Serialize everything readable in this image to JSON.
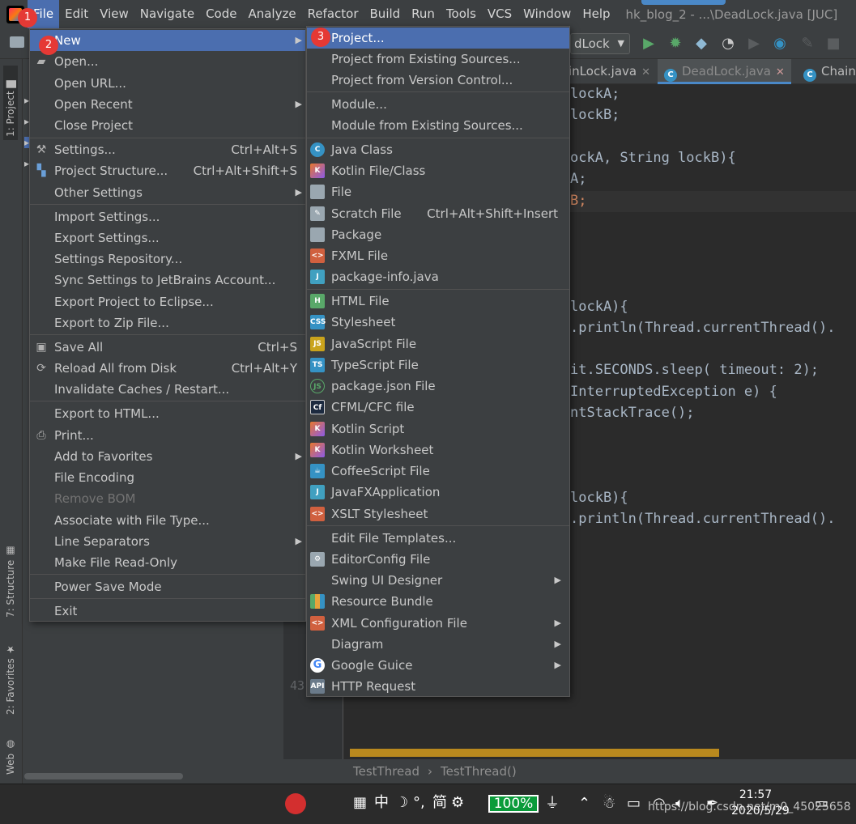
{
  "menubar": {
    "items": [
      "File",
      "Edit",
      "View",
      "Navigate",
      "Code",
      "Analyze",
      "Refactor",
      "Build",
      "Run",
      "Tools",
      "VCS",
      "Window",
      "Help"
    ],
    "window_title": "hk_blog_2 - ...\\DeadLock.java [JUC]"
  },
  "badges": [
    "1",
    "2",
    "3"
  ],
  "toolbar": {
    "run_config": "dLock",
    "icons": [
      "folder-icon",
      "run-icon",
      "debug-icon",
      "coverage-icon",
      "profile-icon",
      "build-icon",
      "help-icon",
      "wrench-icon",
      "stop-icon"
    ]
  },
  "left_strip": {
    "tabs": [
      "1: Project",
      "7: Structure",
      "2: Favorites",
      "Web"
    ]
  },
  "editor": {
    "tabs": [
      {
        "label": "inLock.java",
        "active": false
      },
      {
        "label": "DeadLock.java",
        "active": true
      },
      {
        "label": "ChainR",
        "active": false
      }
    ],
    "line_number": "43",
    "breadcrumb": [
      "TestThread",
      "TestThread()"
    ]
  },
  "file_menu": {
    "items": [
      {
        "label": "New",
        "submenu": true
      },
      {
        "label": "Open..."
      },
      {
        "label": "Open URL..."
      },
      {
        "label": "Open Recent",
        "submenu": true
      },
      {
        "label": "Close Project"
      },
      {
        "label": "Settings...",
        "shortcut": "Ctrl+Alt+S"
      },
      {
        "label": "Project Structure...",
        "shortcut": "Ctrl+Alt+Shift+S"
      },
      {
        "label": "Other Settings",
        "submenu": true
      },
      {
        "label": "Import Settings..."
      },
      {
        "label": "Export Settings..."
      },
      {
        "label": "Settings Repository..."
      },
      {
        "label": "Sync Settings to JetBrains Account..."
      },
      {
        "label": "Export Project to Eclipse..."
      },
      {
        "label": "Export to Zip File..."
      },
      {
        "label": "Save All",
        "shortcut": "Ctrl+S"
      },
      {
        "label": "Reload All from Disk",
        "shortcut": "Ctrl+Alt+Y"
      },
      {
        "label": "Invalidate Caches / Restart..."
      },
      {
        "label": "Export to HTML..."
      },
      {
        "label": "Print..."
      },
      {
        "label": "Add to Favorites",
        "submenu": true
      },
      {
        "label": "File Encoding"
      },
      {
        "label": "Remove BOM",
        "disabled": true
      },
      {
        "label": "Associate with File Type..."
      },
      {
        "label": "Line Separators",
        "submenu": true
      },
      {
        "label": "Make File Read-Only"
      },
      {
        "label": "Power Save Mode"
      },
      {
        "label": "Exit"
      }
    ]
  },
  "new_menu": {
    "items": [
      {
        "label": "Project..."
      },
      {
        "label": "Project from Existing Sources..."
      },
      {
        "label": "Project from Version Control..."
      },
      {
        "label": "Module..."
      },
      {
        "label": "Module from Existing Sources..."
      },
      {
        "label": "Java Class"
      },
      {
        "label": "Kotlin File/Class"
      },
      {
        "label": "File"
      },
      {
        "label": "Scratch File",
        "shortcut": "Ctrl+Alt+Shift+Insert"
      },
      {
        "label": "Package"
      },
      {
        "label": "FXML File"
      },
      {
        "label": "package-info.java"
      },
      {
        "label": "HTML File"
      },
      {
        "label": "Stylesheet"
      },
      {
        "label": "JavaScript File"
      },
      {
        "label": "TypeScript File"
      },
      {
        "label": "package.json File"
      },
      {
        "label": "CFML/CFC file"
      },
      {
        "label": "Kotlin Script"
      },
      {
        "label": "Kotlin Worksheet"
      },
      {
        "label": "CoffeeScript File"
      },
      {
        "label": "JavaFXApplication"
      },
      {
        "label": "XSLT Stylesheet"
      },
      {
        "label": "Edit File Templates..."
      },
      {
        "label": "EditorConfig File"
      },
      {
        "label": "Swing UI Designer",
        "submenu": true
      },
      {
        "label": "Resource Bundle"
      },
      {
        "label": "XML Configuration File",
        "submenu": true
      },
      {
        "label": "Diagram",
        "submenu": true
      },
      {
        "label": "Google Guice",
        "submenu": true
      },
      {
        "label": "HTTP Request"
      }
    ]
  },
  "code": {
    "lines": [
      {
        "text": "lockA;"
      },
      {
        "text": "lockB;"
      },
      {
        "text": "ockA, String lockB){"
      },
      {
        "text": "A;"
      },
      {
        "text": "B;"
      },
      {
        "text": "lockA){"
      },
      {
        "text": ".println(Thread.currentThread()."
      },
      {
        "text": "it.SECONDS.sleep( timeout: 2);"
      },
      {
        "text": "InterruptedException e) {"
      },
      {
        "text": "ntStackTrace();"
      },
      {
        "text": "lockB){"
      },
      {
        "text": ".println(Thread.currentThread()."
      }
    ]
  },
  "taskbar": {
    "ime": [
      "中",
      "°,",
      "简"
    ],
    "battery": "100%",
    "time": "21:57",
    "date": "2020/5/29",
    "watermark": "https://blog.csdn.net/m0_45025658"
  }
}
